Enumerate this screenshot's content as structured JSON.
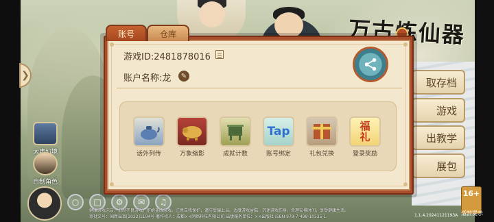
{
  "game": {
    "logo": "万古炼仙器"
  },
  "dialog": {
    "tabs": [
      "账号",
      "仓库"
    ],
    "account_id": "游戏ID:2481878016",
    "account_name": "账户名称:龙",
    "features": [
      {
        "label": "话外列传",
        "icon": "teapot-icon"
      },
      {
        "label": "万象缩影",
        "icon": "pig-statue-icon"
      },
      {
        "label": "成就计数",
        "icon": "bronze-vessel-icon"
      },
      {
        "label": "账号绑定",
        "icon": "tap-logo-icon"
      },
      {
        "label": "礼包兑换",
        "icon": "gift-box-icon"
      },
      {
        "label": "登录奖励",
        "icon": "calligraphy-reward-icon"
      }
    ]
  },
  "right_menu": [
    "取存档",
    "游戏",
    "出教学",
    "展包"
  ],
  "left_side": {
    "items": [
      "太虚幻境",
      "自制角色"
    ]
  },
  "age_rating": {
    "label": "16+",
    "caption": "适龄提示"
  },
  "bottom": {
    "line1": "健康游戏忠告：抵制不良游戏，拒绝盗版游戏。注意自我保护，谨防受骗上当。适度游戏益脑，沉迷游戏伤身。合理安排时间，享受健康生活。",
    "line2": "审批文号：国新出审[2022]1194号 著作权人：成都××网络科技有限公司 出版服务单位：××出版社 ISBN 978-7-498-10335-1",
    "version": "1.1.4.20241121193A"
  },
  "colors": {
    "frame": "#a94e2a",
    "parchment": "#f3e7cd",
    "accent": "#3d7f8c"
  }
}
